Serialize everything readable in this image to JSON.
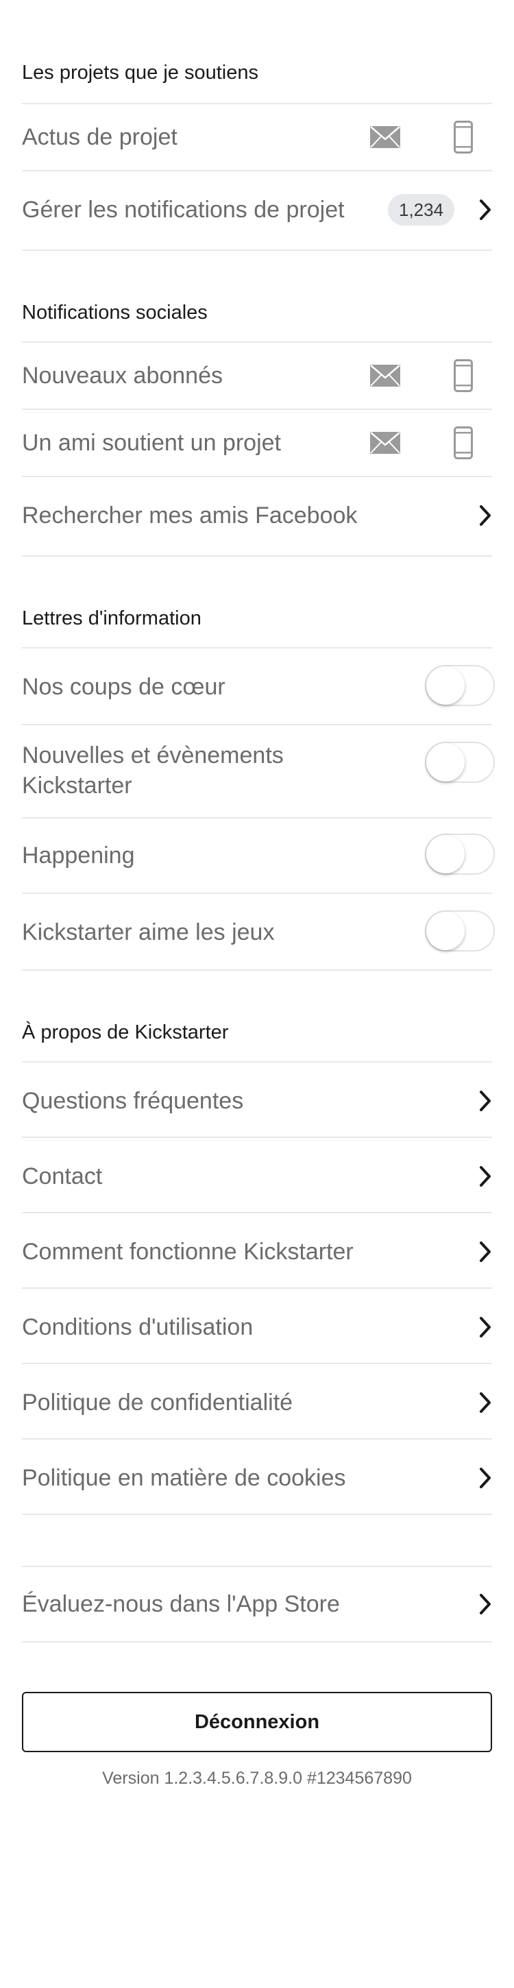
{
  "backed_projects": {
    "header": "Les projets que je soutiens",
    "project_updates": "Actus de projet",
    "manage_notifications": "Gérer les notifications de projet",
    "count_badge": "1,234"
  },
  "social": {
    "header": "Notifications sociales",
    "new_followers": "Nouveaux abonnés",
    "friend_backs": "Un ami soutient un projet",
    "find_facebook": "Rechercher mes amis Facebook"
  },
  "newsletters": {
    "header": "Lettres d'information",
    "items": [
      {
        "label": "Nos coups de cœur",
        "enabled": false
      },
      {
        "label": "Nouvelles et évènements Kickstarter",
        "enabled": false
      },
      {
        "label": "Happening",
        "enabled": false
      },
      {
        "label": "Kickstarter aime les jeux",
        "enabled": false
      }
    ]
  },
  "about": {
    "header": "À propos de Kickstarter",
    "items": [
      "Questions fréquentes",
      "Contact",
      "Comment fonctionne Kickstarter",
      "Conditions d'utilisation",
      "Politique de confidentialité",
      "Politique en matière de cookies"
    ]
  },
  "rate": {
    "label": "Évaluez-nous dans l'App Store"
  },
  "logout_label": "Déconnexion",
  "version": "Version 1.2.3.4.5.6.7.8.9.0 #1234567890",
  "icons": {
    "mail": "mail-icon",
    "phone": "phone-icon",
    "chevron": "chevron-right-icon"
  },
  "colors": {
    "text": "#6b6b6b",
    "header": "#1a1a1a",
    "divider": "#e8e8e8",
    "icon_gray": "#9a9a9a",
    "badge_bg": "#e6e8eb"
  }
}
